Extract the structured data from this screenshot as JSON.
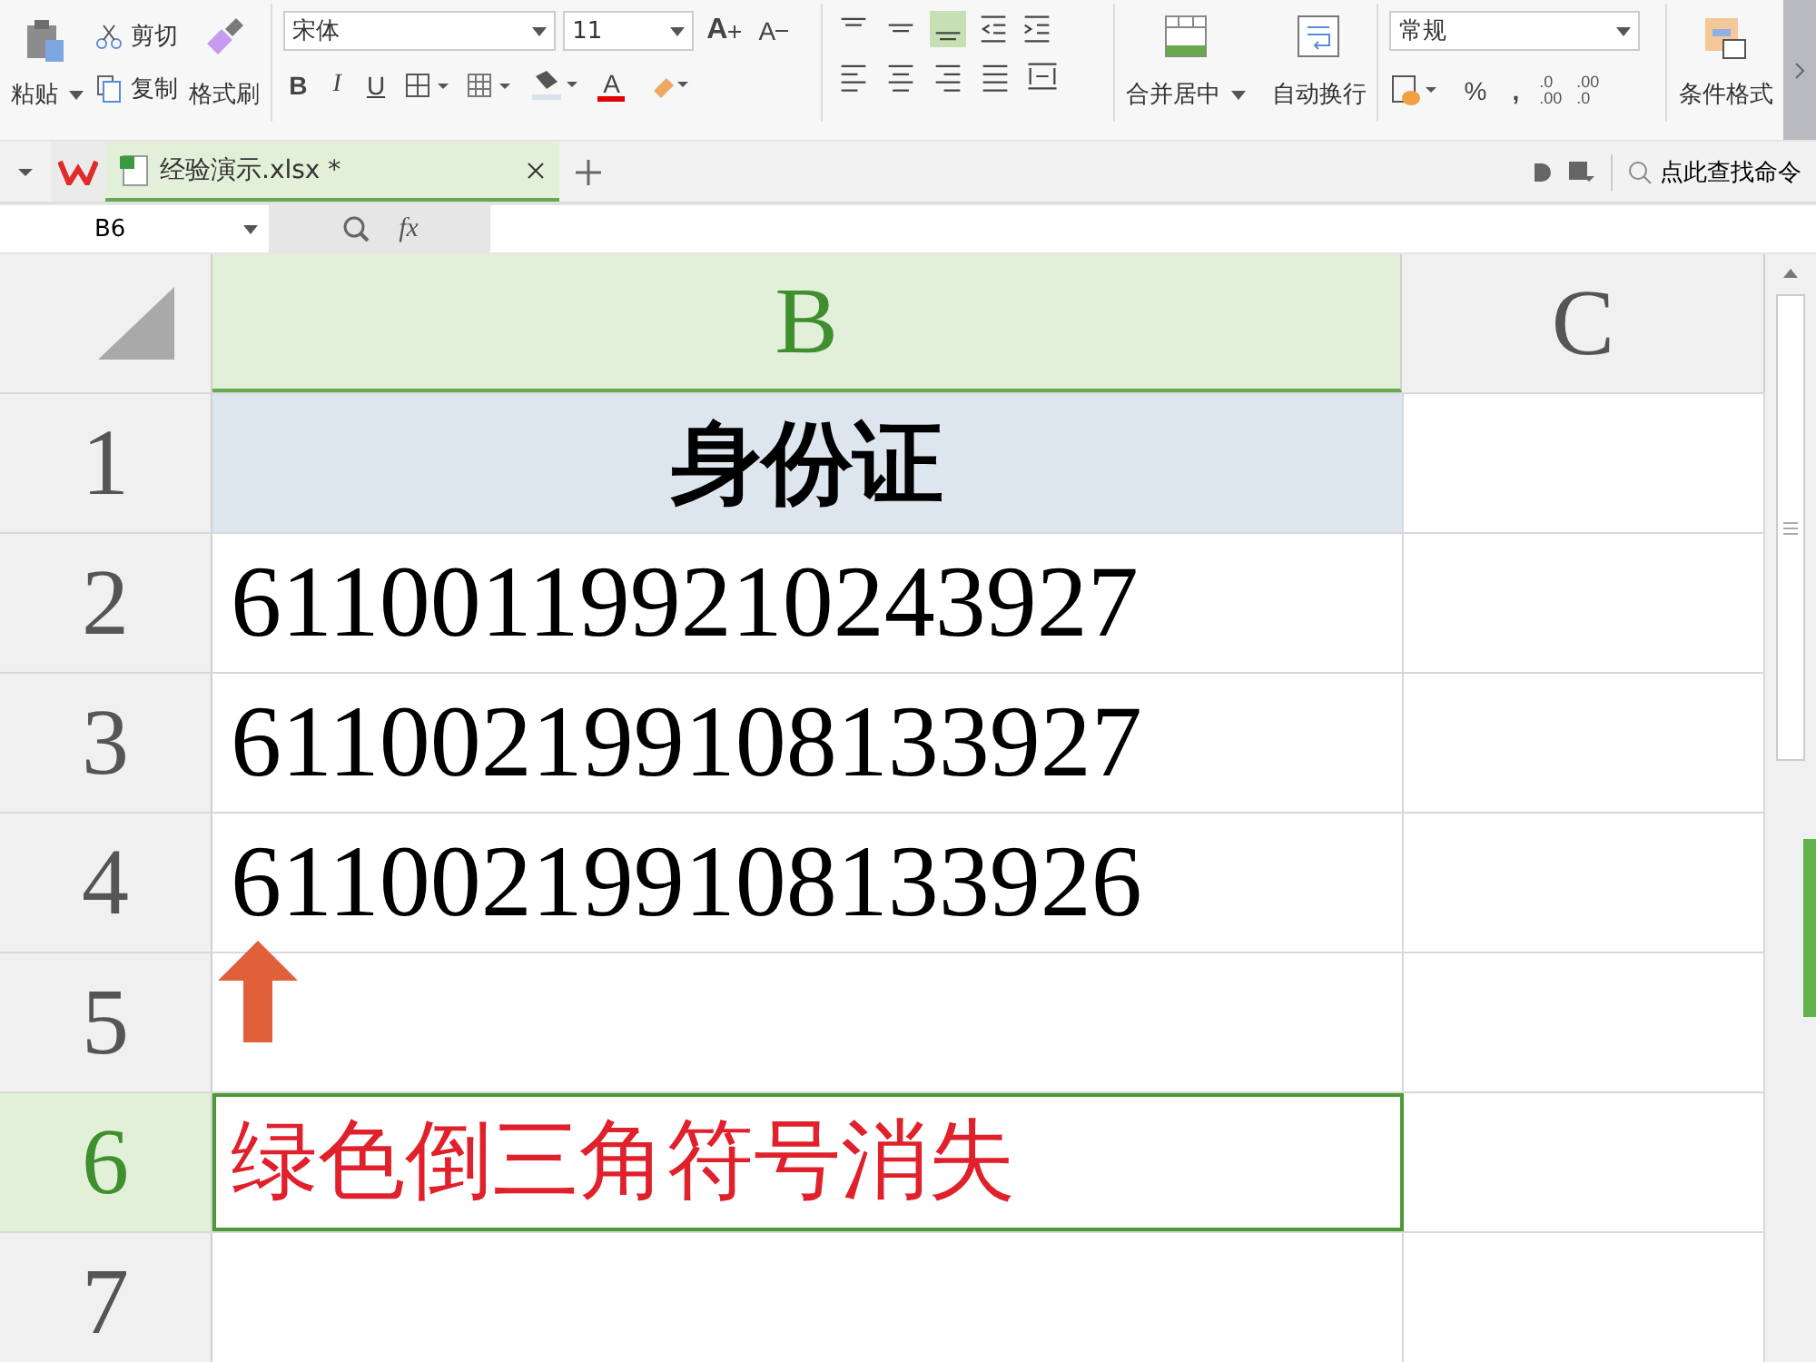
{
  "ribbon": {
    "clipboard": {
      "paste": "粘贴",
      "cut": "剪切",
      "copy": "复制",
      "format_painter": "格式刷"
    },
    "font": {
      "name": "宋体",
      "size": "11",
      "grow": "A",
      "shrink": "A",
      "bold": "B",
      "italic": "I",
      "underline": "U",
      "color_letter": "A"
    },
    "align_buttons": [
      {
        "kind": "top",
        "selected": false
      },
      {
        "kind": "middle",
        "selected": false
      },
      {
        "kind": "bottom",
        "selected": true
      }
    ],
    "merge": "合并居中",
    "wrap": "自动换行",
    "number_format": "常规",
    "percent": "%",
    "comma": ",",
    "inc_decimal": [
      ".0",
      ".00"
    ],
    "dec_decimal": [
      ".00",
      ".0"
    ],
    "conditional": "条件格式"
  },
  "tab_bar": {
    "file_tab": {
      "label": "经验演示.xlsx *",
      "selected": true
    },
    "search": "点此查找命令"
  },
  "formula_bar": {
    "cell_ref": "B6",
    "fx": "fx"
  },
  "sheet": {
    "columns": [
      {
        "label": "B",
        "selected": true
      },
      {
        "label": "C",
        "selected": false
      }
    ],
    "rows": [
      {
        "number": "1",
        "selected": false,
        "kind": "header",
        "cells": [
          "身份证",
          ""
        ]
      },
      {
        "number": "2",
        "selected": false,
        "kind": "data",
        "cells": [
          "611001199210243927",
          ""
        ]
      },
      {
        "number": "3",
        "selected": false,
        "kind": "data",
        "cells": [
          "611002199108133927",
          ""
        ]
      },
      {
        "number": "4",
        "selected": false,
        "kind": "data",
        "cells": [
          "611002199108133926",
          ""
        ]
      },
      {
        "number": "5",
        "selected": false,
        "kind": "data",
        "cells": [
          "",
          ""
        ]
      },
      {
        "number": "6",
        "selected": true,
        "kind": "note",
        "cells": [
          "绿色倒三角符号消失",
          ""
        ]
      },
      {
        "number": "7",
        "selected": false,
        "kind": "data",
        "cells": [
          "",
          ""
        ]
      }
    ]
  }
}
